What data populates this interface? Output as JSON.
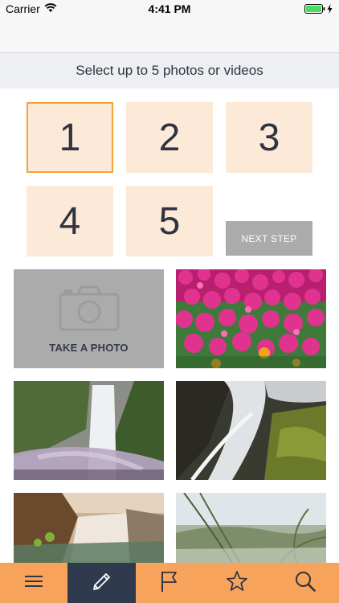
{
  "status_bar": {
    "carrier": "Carrier",
    "time": "4:41 PM",
    "battery_level": 1.0
  },
  "instruction": "Select up to 5 photos or videos",
  "slots": [
    {
      "label": "1",
      "active": true
    },
    {
      "label": "2",
      "active": false
    },
    {
      "label": "3",
      "active": false
    },
    {
      "label": "4",
      "active": false
    },
    {
      "label": "5",
      "active": false
    }
  ],
  "next_step_label": "NEXT STEP",
  "take_photo_label": "TAKE A PHOTO",
  "photos": [
    {
      "subject": "pink-flower-field"
    },
    {
      "subject": "misty-waterfall"
    },
    {
      "subject": "waterfall-long-exposure"
    },
    {
      "subject": "waterfall-at-sunset"
    },
    {
      "subject": "grass-closeup"
    }
  ],
  "tab_bar": {
    "tabs": [
      {
        "icon": "menu-icon",
        "selected": false
      },
      {
        "icon": "pencil-icon",
        "selected": true
      },
      {
        "icon": "flag-icon",
        "selected": false
      },
      {
        "icon": "star-icon",
        "selected": false
      },
      {
        "icon": "search-icon",
        "selected": false
      }
    ]
  },
  "colors": {
    "accent": "#f7a35b",
    "slot_bg": "#fde9d7",
    "slot_active_border": "#f4a33a",
    "selected_tab": "#2f3a4d",
    "battery": "#4cd964"
  }
}
